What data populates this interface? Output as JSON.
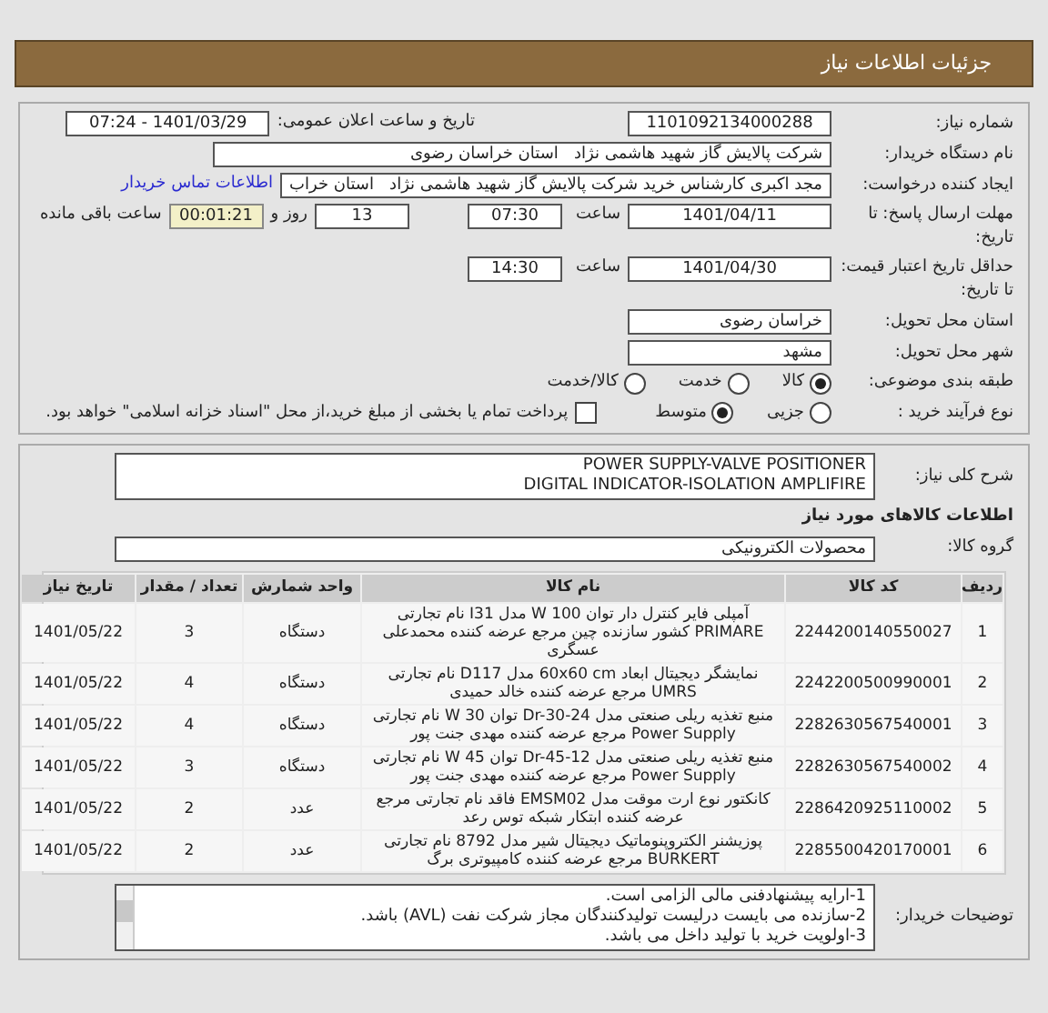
{
  "header": {
    "title": "جزئیات اطلاعات نیاز"
  },
  "fields": {
    "need_number": {
      "label": "شماره نیاز:",
      "value": "1101092134000288"
    },
    "announce": {
      "label": "تاریخ و ساعت اعلان عمومی:",
      "value": "1401/03/29 - 07:24"
    },
    "buyer": {
      "label": "نام دستگاه خریدار:",
      "value": "شرکت پالایش گاز شهید هاشمی نژاد   استان خراسان رضوی"
    },
    "creator": {
      "label": "ایجاد کننده درخواست:",
      "value": "مجد اکبری کارشناس خرید شرکت پالایش گاز شهید هاشمی نژاد   استان خراب",
      "link": "اطلاعات تماس خریدار"
    },
    "deadline": {
      "label": "مهلت ارسال پاسخ: تا تاریخ:",
      "date": "1401/04/11",
      "time_label": "ساعت",
      "time": "07:30",
      "days": "13",
      "days_label": "روز و",
      "remaining": "00:01:21",
      "remaining_label": "ساعت باقی مانده"
    },
    "validity": {
      "label": "حداقل تاریخ اعتبار قیمت: تا تاریخ:",
      "date": "1401/04/30",
      "time_label": "ساعت",
      "time": "14:30"
    },
    "province": {
      "label": "استان محل تحویل:",
      "value": "خراسان رضوی"
    },
    "city": {
      "label": "شهر محل تحویل:",
      "value": "مشهد"
    }
  },
  "category": {
    "label": "طبقه بندی موضوعی:",
    "options": [
      {
        "label": "کالا",
        "selected": true
      },
      {
        "label": "خدمت",
        "selected": false
      },
      {
        "label": "کالا/خدمت",
        "selected": false
      }
    ]
  },
  "process": {
    "label": "نوع فرآیند خرید :",
    "options": [
      {
        "label": "جزیی",
        "selected": false
      },
      {
        "label": "متوسط",
        "selected": true
      }
    ],
    "treasury": {
      "label": "پرداخت تمام یا بخشی از مبلغ خرید،از محل \"اسناد خزانه اسلامی\" خواهد بود.",
      "checked": false
    }
  },
  "summary": {
    "label": "شرح کلی نیاز:",
    "lines": [
      "POWER SUPPLY-VALVE POSITIONER",
      "DIGITAL INDICATOR-ISOLATION AMPLIFIRE"
    ]
  },
  "goods_title": "اطلاعات کالاهای مورد نیاز",
  "group": {
    "label": "گروه کالا:",
    "value": "محصولات الکترونیکی"
  },
  "table": {
    "columns": [
      "ردیف",
      "کد کالا",
      "نام کالا",
      "واحد شمارش",
      "تعداد / مقدار",
      "تاریخ نیاز"
    ],
    "rows": [
      [
        "1",
        "2244200140550027",
        "آمپلی فایر کنترل دار توان W 100 مدل I31 نام تجارتی PRIMARE کشور سازنده چین مرجع عرضه کننده محمدعلی عسگری",
        "دستگاه",
        "3",
        "1401/05/22"
      ],
      [
        "2",
        "2242200500990001",
        "نمایشگر دیجیتال ابعاد 60x60 cm مدل D117 نام تجارتی UMRS مرجع عرضه کننده خالد حمیدی",
        "دستگاه",
        "4",
        "1401/05/22"
      ],
      [
        "3",
        "2282630567540001",
        "منبع تغذیه ریلی صنعتی مدل Dr-30-24 توان W 30 نام تجارتی Power Supply مرجع عرضه کننده مهدی جنت پور",
        "دستگاه",
        "4",
        "1401/05/22"
      ],
      [
        "4",
        "2282630567540002",
        "منبع تغذیه ریلی صنعتی مدل Dr-45-12 توان W 45 نام تجارتی Power Supply مرجع عرضه کننده مهدی جنت پور",
        "دستگاه",
        "3",
        "1401/05/22"
      ],
      [
        "5",
        "2286420925110002",
        "کانکتور نوع ارت موقت مدل EMSM02 فاقد نام تجارتی مرجع عرضه کننده ابتکار شبکه توس رعد",
        "عدد",
        "2",
        "1401/05/22"
      ],
      [
        "6",
        "2285500420170001",
        "پوزیشنر الکتروپنوماتیک دیجیتال شیر مدل 8792 نام تجارتی BURKERT مرجع عرضه کننده کامپیوتری برگ",
        "عدد",
        "2",
        "1401/05/22"
      ]
    ]
  },
  "notes": {
    "label": "توضیحات خریدار:",
    "lines": [
      "1-ارایه پیشنهادفنی مالی الزامی است.",
      "2-سازنده می بایست درلیست تولیدکنندگان مجاز شرکت نفت (AVL)  باشد.",
      "3-اولویت خرید با تولید داخل می باشد."
    ]
  }
}
